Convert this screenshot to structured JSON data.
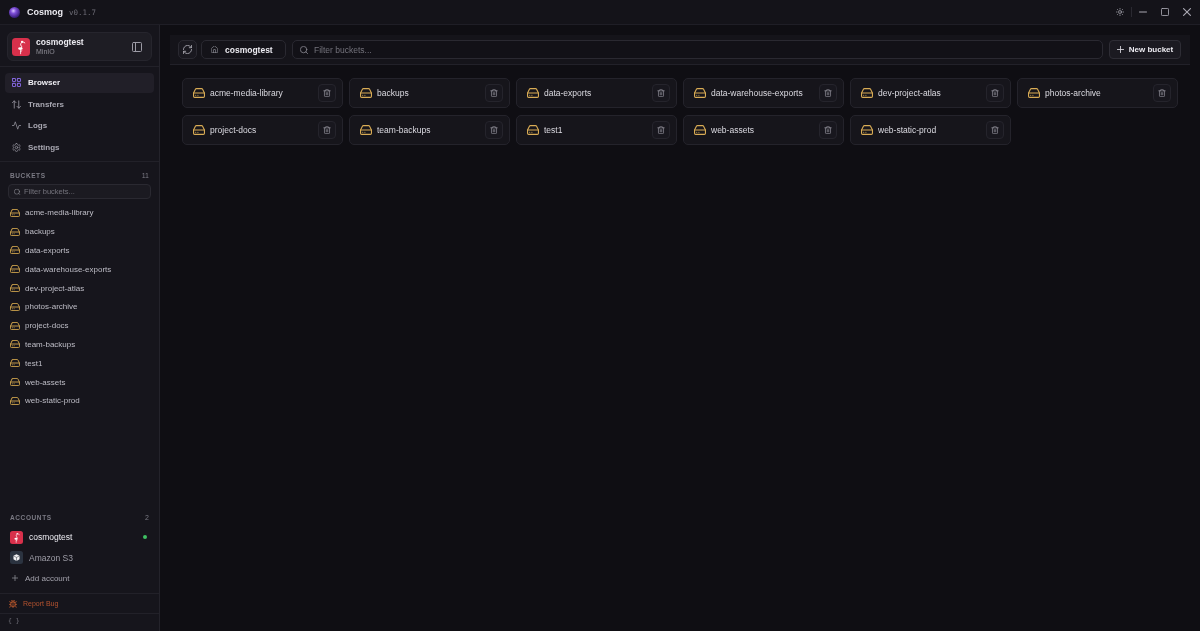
{
  "app": {
    "title": "Cosmog",
    "version": "v0.1.7"
  },
  "sidebar": {
    "account": {
      "name": "cosmogtest",
      "provider": "MinIO",
      "kind": "minio"
    },
    "nav": [
      {
        "label": "Browser",
        "selected": true
      },
      {
        "label": "Transfers",
        "selected": false
      },
      {
        "label": "Logs",
        "selected": false
      },
      {
        "label": "Settings",
        "selected": false
      }
    ],
    "buckets": {
      "title": "BUCKETS",
      "count": "11",
      "filter": {
        "placeholder": "Filter buckets..."
      },
      "items": [
        "acme-media-library",
        "backups",
        "data-exports",
        "data-warehouse-exports",
        "dev-project-atlas",
        "photos-archive",
        "project-docs",
        "team-backups",
        "test1",
        "web-assets",
        "web-static-prod"
      ]
    },
    "accounts": {
      "title": "ACCOUNTS",
      "count": "2",
      "items": [
        {
          "name": "cosmogtest",
          "kind": "minio",
          "connected": true
        },
        {
          "name": "Amazon S3",
          "kind": "s3",
          "connected": false
        }
      ],
      "add_label": "Add account"
    },
    "report_bug": "Report Bug",
    "footer": "{ }"
  },
  "toolbar": {
    "breadcrumb": "cosmogtest",
    "filter": {
      "placeholder": "Filter buckets..."
    },
    "new_bucket": "New bucket"
  },
  "buckets": [
    "acme-media-library",
    "backups",
    "data-exports",
    "data-warehouse-exports",
    "dev-project-atlas",
    "photos-archive",
    "project-docs",
    "team-backups",
    "test1",
    "web-assets",
    "web-static-prod"
  ]
}
